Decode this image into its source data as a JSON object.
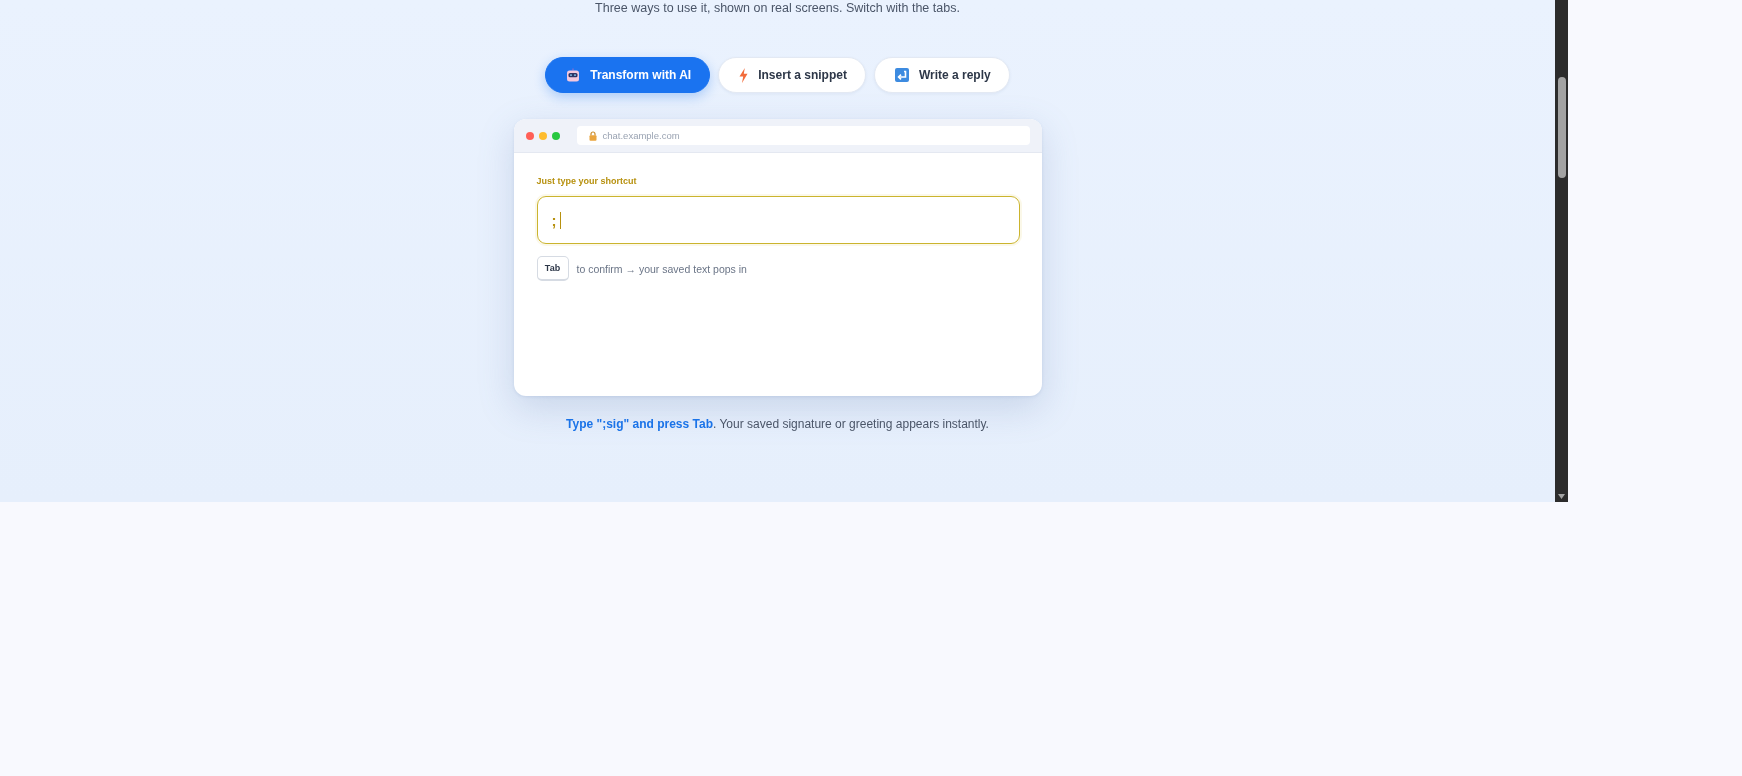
{
  "subtitle": "Three ways to use it, shown on real screens. Switch with the tabs.",
  "tabs": [
    {
      "label": "Transform with AI",
      "selected": true
    },
    {
      "label": "Insert a snippet",
      "selected": false
    },
    {
      "label": "Write a reply",
      "selected": false
    }
  ],
  "browser": {
    "url": "chat.example.com",
    "field": {
      "label": "Just type your shortcut",
      "value": ";",
      "focused": true
    },
    "key": "Tab",
    "hint": "to confirm → your saved text pops in"
  },
  "caption": "**Type \";sig\" and press Tab**. Your saved signature or greeting appears instantly."
}
